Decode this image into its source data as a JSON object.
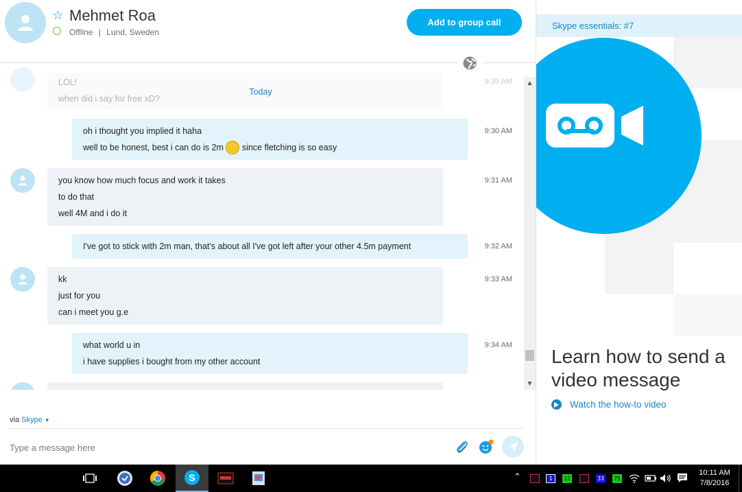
{
  "header": {
    "contact_name": "Mehmet Roa",
    "status": "Offline",
    "location": "Lund, Sweden",
    "status_separator": "|",
    "group_call_label": "Add to group call"
  },
  "conversation": {
    "date_separator": "Today",
    "top_faded": {
      "lines": [
        "LOL!",
        "when did i say for free xD?"
      ],
      "time": "9:30 AM"
    },
    "messages": [
      {
        "from": "me",
        "lines": [
          "oh i thought you implied it haha",
          "well to be honest, best i can do is 2m",
          "since fletching is so easy"
        ],
        "time": "9:30 AM"
      },
      {
        "from": "contact",
        "lines": [
          "you know how much focus and work it takes",
          "to do that",
          "well 4M and i do it"
        ],
        "time": "9:31 AM"
      },
      {
        "from": "me",
        "lines": [
          "I've got to stick with 2m man, that's about all I've got left after your other 4.5m payment"
        ],
        "time": "9:32 AM"
      },
      {
        "from": "contact",
        "lines": [
          "kk",
          "just for you",
          "can i meet you g.e"
        ],
        "time": "9:33 AM"
      },
      {
        "from": "me",
        "lines": [
          "what world u in",
          "i have supplies i bought from my other account"
        ],
        "time": "9:34 AM"
      }
    ]
  },
  "compose": {
    "via_label": "via",
    "via_service": "Skype",
    "placeholder": "Type a message here"
  },
  "essentials": {
    "title": "Skype essentials: #7",
    "heading": "Learn how to send a video message",
    "watch_link": "Watch the how-to video"
  },
  "taskbar": {
    "tray_labels": [
      "1",
      "12",
      "33",
      "75"
    ],
    "time": "10:11 AM",
    "date": "7/8/2016"
  },
  "colors": {
    "accent": "#00aff0",
    "link": "#1a86c4",
    "incoming_bubble": "#eef1f6",
    "outgoing_bubble": "#e3f3fb"
  }
}
